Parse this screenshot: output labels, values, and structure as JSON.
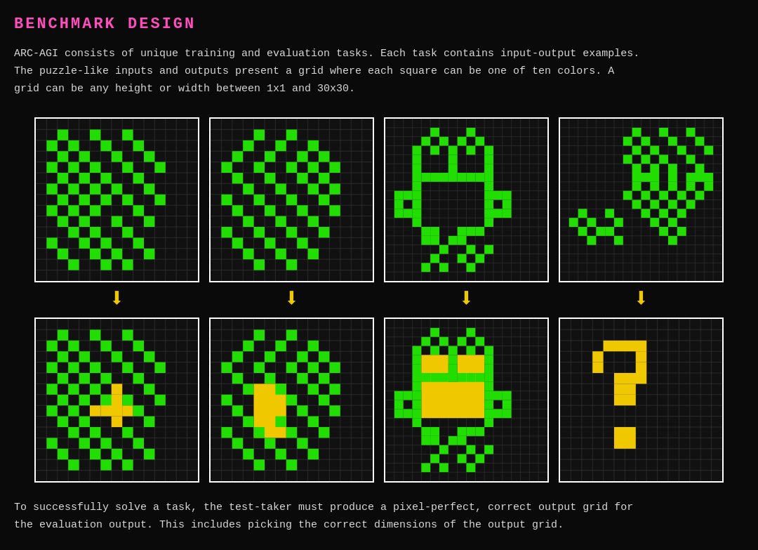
{
  "title": "BENCHMARK DESIGN",
  "description_line1": "ARC-AGI consists of unique training and evaluation tasks. Each task contains input-output examples.",
  "description_line2": "The puzzle-like inputs and outputs present a grid where each square can be one of ten colors. A",
  "description_line3": "grid can be any height or width between 1x1 and 30x30.",
  "footer_line1": "To successfully solve a task, the test-taker must produce a pixel-perfect, correct output grid for",
  "footer_line2": "the evaluation output. This includes picking the correct dimensions of the output grid.",
  "colors": {
    "title": "#ff4dbd",
    "background": "#0a0a0a",
    "green": "#22dd00",
    "yellow": "#f0c800",
    "black": "#111111",
    "white": "#ffffff"
  }
}
